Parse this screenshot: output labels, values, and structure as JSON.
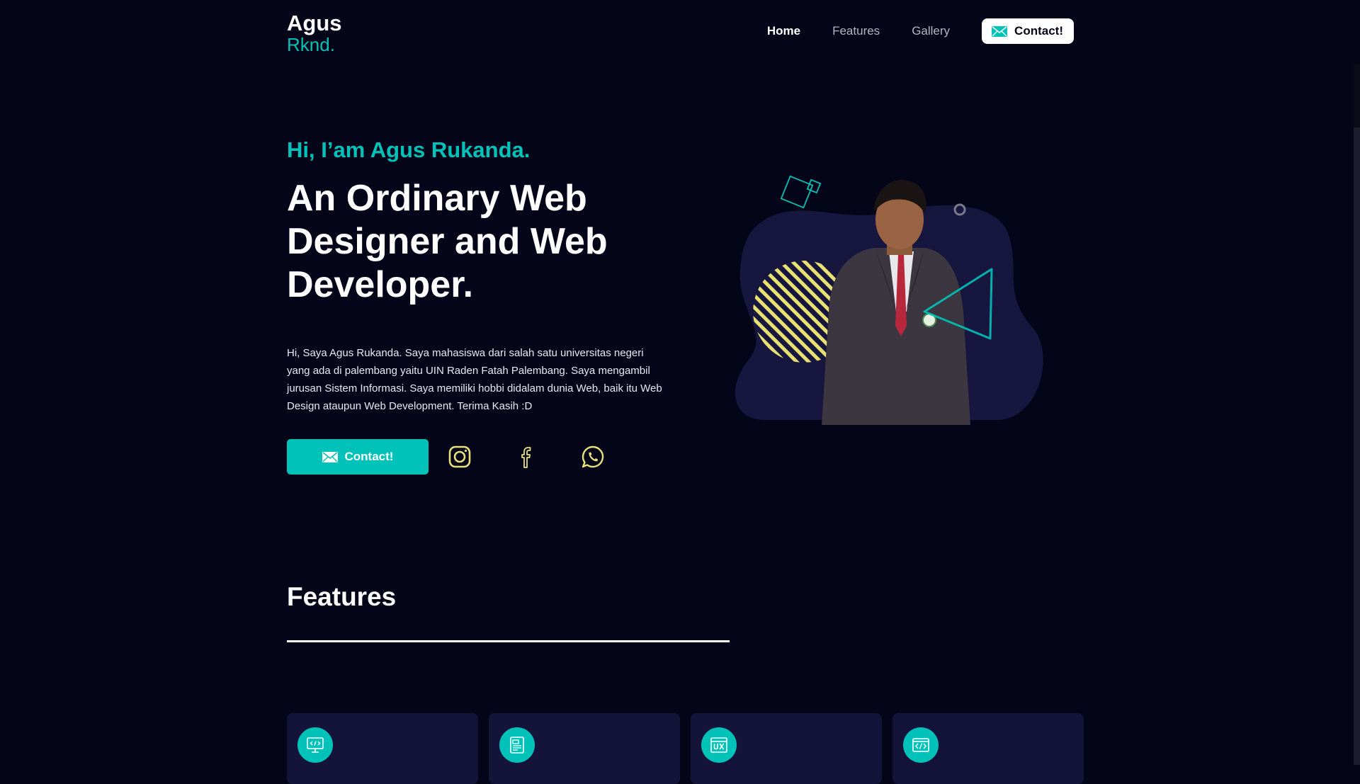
{
  "logo": {
    "line1": "Agus",
    "line2": "Rknd."
  },
  "nav": {
    "items": [
      {
        "label": "Home",
        "active": true
      },
      {
        "label": "Features",
        "active": false
      },
      {
        "label": "Gallery",
        "active": false
      }
    ],
    "contact_label": "Contact!",
    "contact_icon": "mail-icon"
  },
  "hero": {
    "greeting": "Hi, I’am Agus Rukanda.",
    "headline": [
      "An Ordinary Web",
      "Designer and Web",
      "Developer."
    ],
    "description": "Hi, Saya Agus Rukanda. Saya mahasiswa dari salah satu universitas negeri yang ada di palembang yaitu UIN Raden Fatah Palembang. Saya mengambil jurusan Sistem Informasi. Saya memiliki hobbi didalam dunia Web, baik itu Web Design ataupun Web Development. Terima Kasih :D",
    "cta_label": "Contact!",
    "social_icons": [
      "instagram-icon",
      "facebook-icon",
      "whatsapp-icon"
    ]
  },
  "features": {
    "title": "Features",
    "card_icons": [
      "web-design-icon",
      "web-layout-icon",
      "ux-icon",
      "code-icon"
    ]
  },
  "colors": {
    "background": "#05051a",
    "accent": "#00c2b8",
    "card": "#14143a",
    "social": "#e8e07a",
    "stripe": "#e8e070"
  }
}
